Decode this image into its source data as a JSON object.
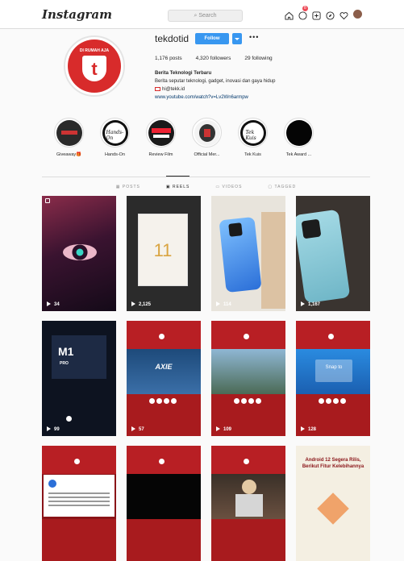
{
  "header": {
    "logo": "Instagram",
    "search_placeholder": "Search",
    "notification_count": "8"
  },
  "profile": {
    "username": "tekdotid",
    "follow_label": "Follow",
    "avatar_text": "DI RUMAH AJA",
    "avatar_letter": "t",
    "stats": {
      "posts": "1,176 posts",
      "followers": "4,320 followers",
      "following": "29 following"
    },
    "bio_name": "Berita Teknologi Terbaru",
    "bio_text": "Berita seputar teknologi, gadget, inovasi dan gaya hidup",
    "email": "hi@tekk.id",
    "link": "www.youtube.com/watch?v=Lv2Wn6armpw"
  },
  "highlights": [
    {
      "label": "Giveaway🎁"
    },
    {
      "label": "Hands-On"
    },
    {
      "label": "Review Film"
    },
    {
      "label": "Official Mer..."
    },
    {
      "label": "Tek Kuis"
    },
    {
      "label": "Tek Award ..."
    }
  ],
  "tabs": [
    "POSTS",
    "REELS",
    "VIDEOS",
    "TAGGED"
  ],
  "posts": [
    {
      "views": "34"
    },
    {
      "views": "2,125"
    },
    {
      "views": "114"
    },
    {
      "views": "1,167"
    },
    {
      "views": "99"
    },
    {
      "views": "57"
    },
    {
      "views": "109"
    },
    {
      "views": "128"
    },
    {
      "views": ""
    },
    {
      "views": ""
    },
    {
      "views": ""
    },
    {
      "views": ""
    }
  ],
  "post_text": {
    "phone_box_number": "11",
    "m1_logo": "M1",
    "m1_sub": "PRO",
    "axie_title": "AXIE",
    "snap_text": "Snap to",
    "android_title": "Android 12 Segera Rilis, Berikut Fitur Kelebihannya"
  },
  "colors": {
    "accent": "#3897f0",
    "brand_red": "#b81f24"
  }
}
